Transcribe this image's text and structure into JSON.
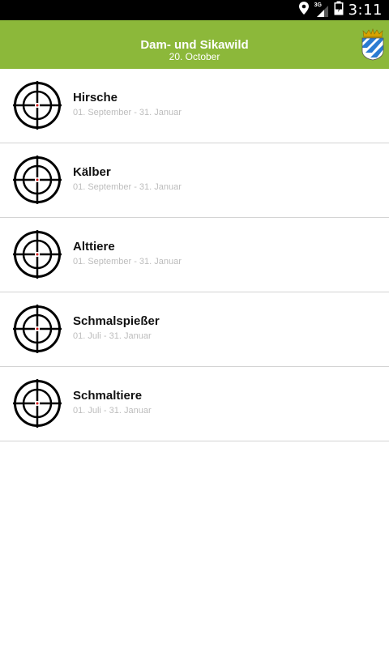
{
  "status_bar": {
    "time": "3:11",
    "network": "3G",
    "icons": [
      "location-pin-icon",
      "signal-icon",
      "battery-icon"
    ]
  },
  "header": {
    "title": "Dam- und Sikawild",
    "subtitle": "20. October",
    "crest_icon": "bavaria-crest-icon",
    "background_color": "#8cb83a"
  },
  "list": {
    "items": [
      {
        "name": "Hirsche",
        "season": "01. September - 31. Januar",
        "icon": "crosshair-icon"
      },
      {
        "name": "Kälber",
        "season": "01. September - 31. Januar",
        "icon": "crosshair-icon"
      },
      {
        "name": "Alttiere",
        "season": "01. September - 31. Januar",
        "icon": "crosshair-icon"
      },
      {
        "name": "Schmalspießer",
        "season": "01. Juli - 31. Januar",
        "icon": "crosshair-icon"
      },
      {
        "name": "Schmaltiere",
        "season": "01. Juli - 31. Januar",
        "icon": "crosshair-icon"
      }
    ]
  }
}
